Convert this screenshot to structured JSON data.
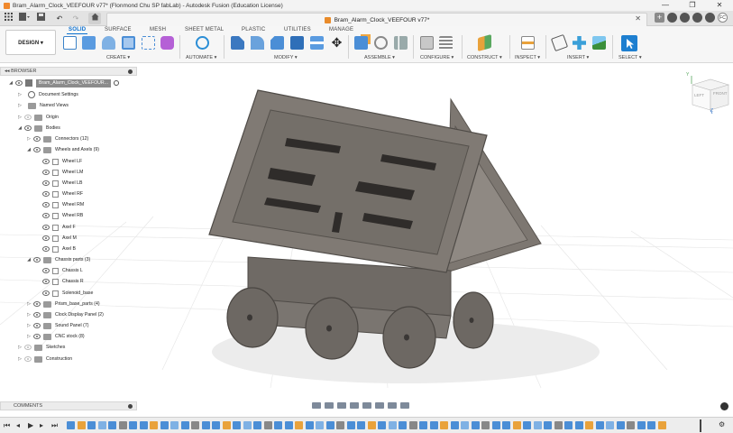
{
  "window": {
    "title": "Bram_Alarm_Clock_VEEFOUR v77* (Flonmond Chu SP fabLab) - Autodesk Fusion (Education License)",
    "controls": [
      "—",
      "❐",
      "✕"
    ]
  },
  "tabs": {
    "document_title": "Bram_Alarm_Clock_VEEFOUR v77*",
    "close_glyph": "✕"
  },
  "user": {
    "initials": "FC"
  },
  "ribbon": {
    "design_label": "DESIGN ▾",
    "tabs": [
      {
        "label": "SOLID",
        "active": true
      },
      {
        "label": "SURFACE"
      },
      {
        "label": "MESH"
      },
      {
        "label": "SHEET METAL"
      },
      {
        "label": "PLASTIC"
      },
      {
        "label": "UTILITIES"
      },
      {
        "label": "MANAGE"
      }
    ],
    "groups": [
      {
        "label": "CREATE ▾"
      },
      {
        "label": "AUTOMATE ▾"
      },
      {
        "label": "MODIFY ▾"
      },
      {
        "label": "ASSEMBLE ▾"
      },
      {
        "label": "CONFIGURE ▾"
      },
      {
        "label": "CONSTRUCT ▾"
      },
      {
        "label": "INSPECT ▾"
      },
      {
        "label": "INSERT ▾"
      },
      {
        "label": "SELECT ▾"
      }
    ]
  },
  "browser": {
    "header": "BROWSER",
    "root": "Bram_Alarm_Clock_VEEFOUR...",
    "items": [
      {
        "label": "Document Settings"
      },
      {
        "label": "Named Views"
      },
      {
        "label": "Origin"
      },
      {
        "label": "Bodies"
      },
      {
        "label": "Connectors (12)"
      },
      {
        "label": "Wheels and Axels (9)"
      },
      {
        "label": "Wheel LF"
      },
      {
        "label": "Wheel LM"
      },
      {
        "label": "Wheel LB"
      },
      {
        "label": "Wheel RF"
      },
      {
        "label": "Wheel RM"
      },
      {
        "label": "Wheel RB"
      },
      {
        "label": "Axel F"
      },
      {
        "label": "Axel M"
      },
      {
        "label": "Axel B"
      },
      {
        "label": "Chassis parts (3)"
      },
      {
        "label": "Chassis L"
      },
      {
        "label": "Chassis R"
      },
      {
        "label": "Solenoid_base"
      },
      {
        "label": "Prism_base_parts (4)"
      },
      {
        "label": "Clock Display Panel (2)"
      },
      {
        "label": "Sound Panel (7)"
      },
      {
        "label": "CNC stock (8)"
      },
      {
        "label": "Sketches"
      },
      {
        "label": "Construction"
      }
    ]
  },
  "viewcube": {
    "left": "LEFT",
    "front": "FRONT",
    "axis_z": "Z",
    "axis_y": "Y"
  },
  "comments": {
    "label": "COMMENTS"
  },
  "colors": {
    "accent": "#0a6fcf",
    "model": "#7a7570",
    "orange": "#e98b2a"
  }
}
